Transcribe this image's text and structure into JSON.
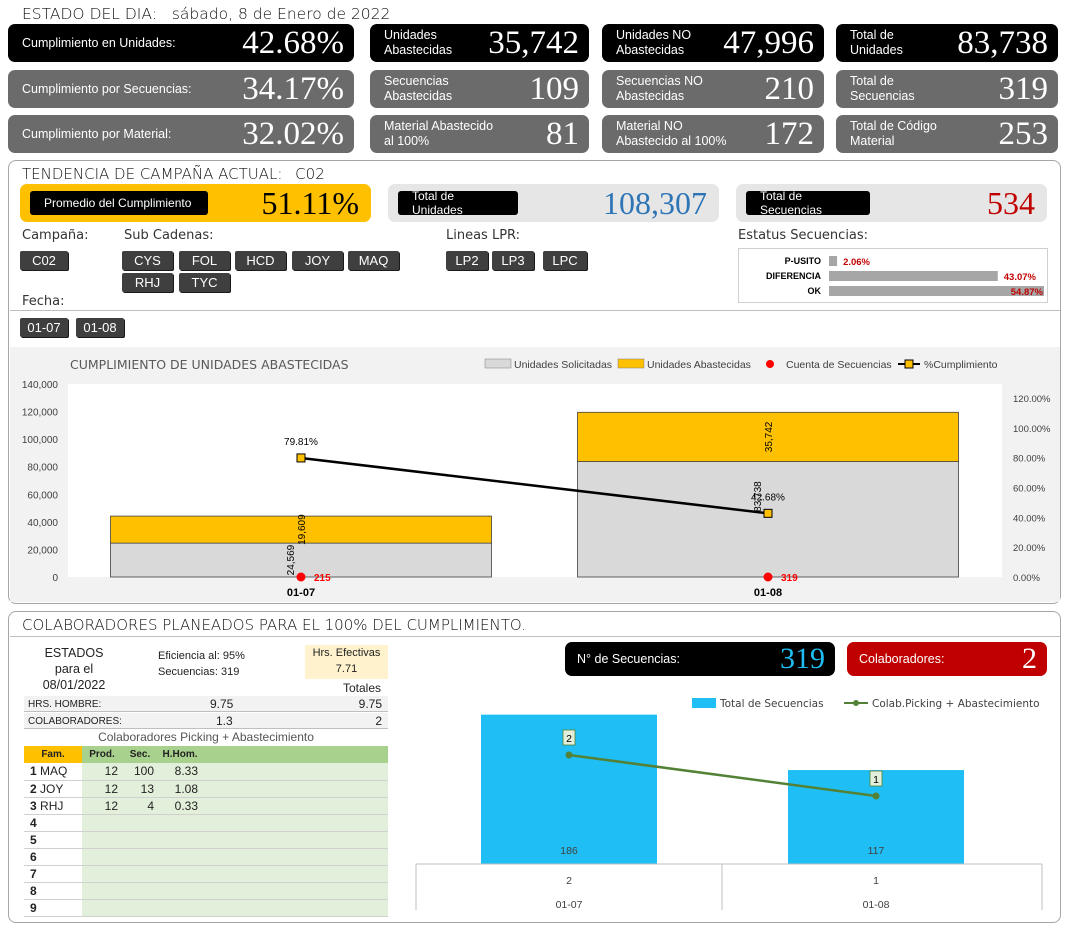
{
  "header": {
    "title": "ESTADO DEL DIA:",
    "date": "sábado, 8 de Enero de 2022"
  },
  "kpis": [
    {
      "label": "Cumplimiento en Unidades:",
      "value": "42.68%"
    },
    {
      "label": "Unidades\nAbastecidas",
      "value": "35,742"
    },
    {
      "label": "Unidades NO\nAbastecidas",
      "value": "47,996"
    },
    {
      "label": "Total de\nUnidades",
      "value": "83,738"
    },
    {
      "label": "Cumplimiento por Secuencias:",
      "value": "34.17%"
    },
    {
      "label": "Secuencias\nAbastecidas",
      "value": "109"
    },
    {
      "label": "Secuencias NO\nAbastecidas",
      "value": "210"
    },
    {
      "label": "Total de\nSecuencias",
      "value": "319"
    },
    {
      "label": "Cumplimiento por Material:",
      "value": "32.02%"
    },
    {
      "label": "Material Abastecido\nal 100%",
      "value": "81"
    },
    {
      "label": "Material NO\nAbastecido al 100%",
      "value": "172"
    },
    {
      "label": "Total de Código\nMaterial",
      "value": "253"
    }
  ],
  "campaign": {
    "title": "TENDENCIA DE CAMPAÑA ACTUAL:",
    "code": "C02",
    "avg_label": "Promedio  del Cumplimiento",
    "avg_value": "51.11%",
    "units_label": "Total de Unidades",
    "units_value": "108,307",
    "seq_label": "Total de Secuencias",
    "seq_value": "534"
  },
  "filters": {
    "campana_label": "Campaña:",
    "campana": [
      "C02"
    ],
    "sub_label": "Sub Cadenas:",
    "sub": [
      "CYS",
      "FOL",
      "HCD",
      "JOY",
      "MAQ",
      "RHJ",
      "TYC"
    ],
    "lineas_label": "Lineas LPR:",
    "lineas": [
      "LP2",
      "LP3",
      "LPC"
    ],
    "fecha_label": "Fecha:",
    "fechas": [
      "01-07",
      "01-08"
    ],
    "estatus_label": "Estatus Secuencias:"
  },
  "estatus": {
    "rows": [
      {
        "label": "P-USITO",
        "value": "2.06%",
        "pct": 2.06
      },
      {
        "label": "DIFERENCIA",
        "value": "43.07%",
        "pct": 43.07
      },
      {
        "label": "OK",
        "value": "54.87%",
        "pct": 54.87
      }
    ]
  },
  "chart_data": [
    {
      "type": "bar",
      "title": "CUMPLIMIENTO DE UNIDADES ABASTECIDAS",
      "legend": [
        "Unidades Solicitadas",
        "Unidades Abastecidas",
        "Cuenta de Secuencias",
        "%Cumplimiento"
      ],
      "categories": [
        "01-07",
        "01-08"
      ],
      "series": [
        {
          "name": "Unidades Solicitadas",
          "values": [
            24569,
            83738
          ],
          "labels": [
            "24,569",
            "83,738"
          ],
          "color": "#d9d9d9"
        },
        {
          "name": "Unidades Abastecidas",
          "values": [
            19609,
            35742
          ],
          "labels": [
            "19,609",
            "35,742"
          ],
          "color": "#ffc000"
        },
        {
          "name": "Cuenta de Secuencias",
          "values": [
            215,
            319
          ],
          "labels": [
            "215",
            "319"
          ],
          "color": "#ff0000"
        },
        {
          "name": "%Cumplimiento",
          "values": [
            79.81,
            42.68
          ],
          "labels": [
            "79.81%",
            "42.68%"
          ],
          "color": "#000000"
        }
      ],
      "yticks": [
        "140,000",
        "120,000",
        "100,000",
        "80,000",
        "60,000",
        "40,000",
        "20,000",
        "0"
      ],
      "y2ticks": [
        "120.00%",
        "100.00%",
        "80.00%",
        "60.00%",
        "40.00%",
        "20.00%",
        "0.00%"
      ],
      "ylim": [
        0,
        140000
      ],
      "y2lim": [
        0,
        120
      ]
    },
    {
      "type": "bar",
      "legend": [
        "Total de Secuencias",
        "Colab.Picking + Abastecimiento"
      ],
      "categories": [
        "01-07",
        "01-08"
      ],
      "sub_categories": [
        "2",
        "1"
      ],
      "series": [
        {
          "name": "Total de Secuencias",
          "values": [
            186,
            117
          ],
          "labels": [
            "186",
            "117"
          ],
          "color": "#1fbff5"
        },
        {
          "name": "Colab.Picking + Abastecimiento",
          "values": [
            2,
            1
          ],
          "labels": [
            "2",
            "1"
          ],
          "color": "#538135"
        }
      ]
    }
  ],
  "colab": {
    "title": "COLABORADORES PLANEADOS PARA EL 100% DEL CUMPLIMIENTO.",
    "estados": "ESTADOS",
    "para": "para el",
    "fecha": "08/01/2022",
    "eficiencia_label": "Eficiencia al:",
    "eficiencia": "95%",
    "secuencias_label": "Secuencias:",
    "secuencias": "319",
    "hrs_label": "Hrs. Efectivas",
    "hrs": "7.71",
    "totales": "Totales",
    "hrs_hombre_label": "HRS. HOMBRE:",
    "hrs_hombre": "9.75",
    "hrs_hombre_total": "9.75",
    "colaboradores_label": "COLABORADORES:",
    "colaboradores": "1.3",
    "colaboradores_total": "2",
    "sub_title": "Colaboradores Picking + Abastecimiento",
    "headers": [
      "Fam.",
      "Prod.",
      "Sec.",
      "H.Hom."
    ],
    "rows": [
      {
        "n": "1",
        "fam": "MAQ",
        "prod": "12",
        "sec": "100",
        "hh": "8.33"
      },
      {
        "n": "2",
        "fam": "JOY",
        "prod": "12",
        "sec": "13",
        "hh": "1.08"
      },
      {
        "n": "3",
        "fam": "RHJ",
        "prod": "12",
        "sec": "4",
        "hh": "0.33"
      },
      {
        "n": "4",
        "fam": "",
        "prod": "",
        "sec": "",
        "hh": ""
      },
      {
        "n": "5",
        "fam": "",
        "prod": "",
        "sec": "",
        "hh": ""
      },
      {
        "n": "6",
        "fam": "",
        "prod": "",
        "sec": "",
        "hh": ""
      },
      {
        "n": "7",
        "fam": "",
        "prod": "",
        "sec": "",
        "hh": ""
      },
      {
        "n": "8",
        "fam": "",
        "prod": "",
        "sec": "",
        "hh": ""
      },
      {
        "n": "9",
        "fam": "",
        "prod": "",
        "sec": "",
        "hh": ""
      }
    ],
    "nsec_label": "N° de Secuencias:",
    "nsec": "319",
    "colab_label": "Colaboradores:",
    "colab_value": "2"
  },
  "colors": {
    "black": "#000000",
    "gray": "#6b6b6b",
    "gold": "#ffc000",
    "blue": "#2e75b6",
    "red": "#c00000",
    "cyan": "#1fbff5"
  }
}
